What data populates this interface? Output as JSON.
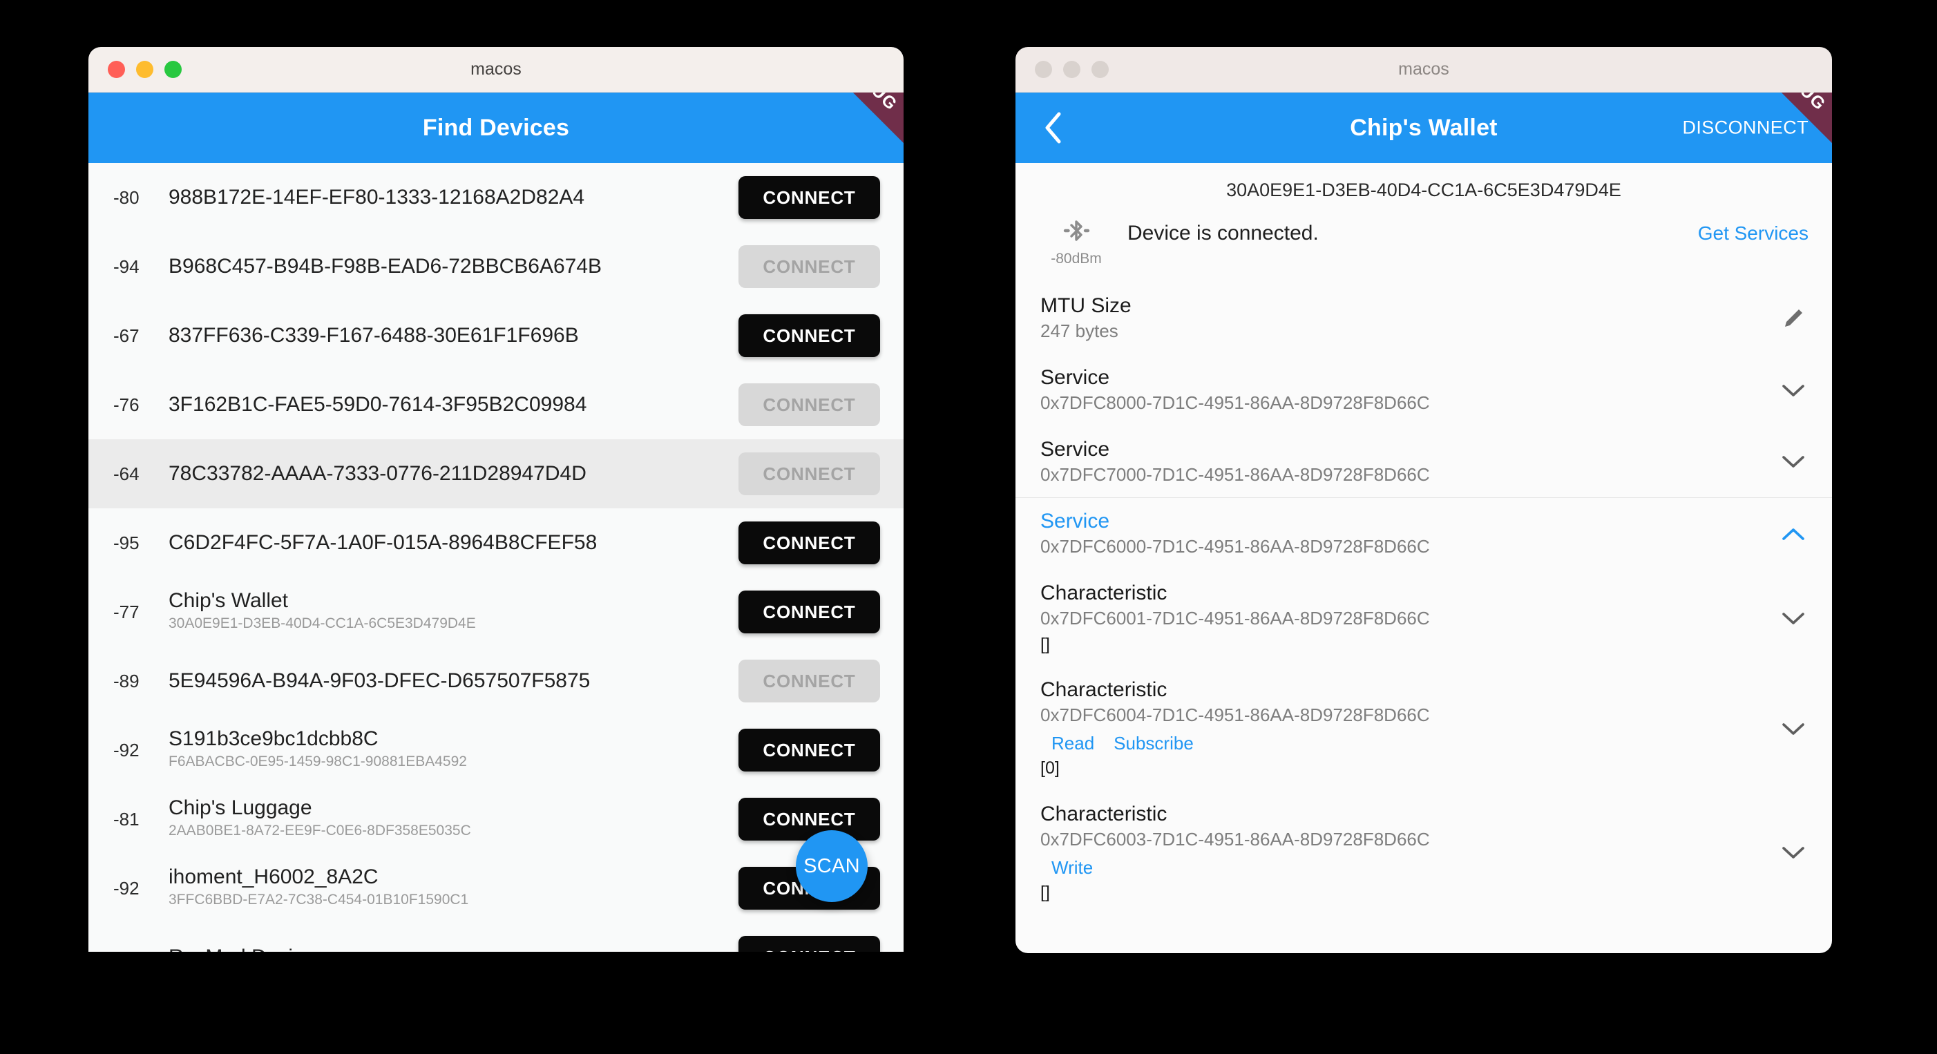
{
  "windows": {
    "left": {
      "os_title": "macos",
      "appbar_title": "Find Devices",
      "ribbon_label": "DEBUG",
      "scan_button_label": "SCAN",
      "traffic_lights": [
        "close",
        "minimize",
        "zoom"
      ],
      "devices": [
        {
          "rssi": "-80",
          "name": "988B172E-14EF-EF80-1333-12168A2D82A4",
          "sub": "",
          "button_label": "CONNECT",
          "enabled": true,
          "highlighted": false
        },
        {
          "rssi": "-94",
          "name": "B968C457-B94B-F98B-EAD6-72BBCB6A674B",
          "sub": "",
          "button_label": "CONNECT",
          "enabled": false,
          "highlighted": false
        },
        {
          "rssi": "-67",
          "name": "837FF636-C339-F167-6488-30E61F1F696B",
          "sub": "",
          "button_label": "CONNECT",
          "enabled": true,
          "highlighted": false
        },
        {
          "rssi": "-76",
          "name": "3F162B1C-FAE5-59D0-7614-3F95B2C09984",
          "sub": "",
          "button_label": "CONNECT",
          "enabled": false,
          "highlighted": false
        },
        {
          "rssi": "-64",
          "name": "78C33782-AAAA-7333-0776-211D28947D4D",
          "sub": "",
          "button_label": "CONNECT",
          "enabled": false,
          "highlighted": true
        },
        {
          "rssi": "-95",
          "name": "C6D2F4FC-5F7A-1A0F-015A-8964B8CFEF58",
          "sub": "",
          "button_label": "CONNECT",
          "enabled": true,
          "highlighted": false
        },
        {
          "rssi": "-77",
          "name": "Chip's Wallet",
          "sub": "30A0E9E1-D3EB-40D4-CC1A-6C5E3D479D4E",
          "button_label": "CONNECT",
          "enabled": true,
          "highlighted": false
        },
        {
          "rssi": "-89",
          "name": "5E94596A-B94A-9F03-DFEC-D657507F5875",
          "sub": "",
          "button_label": "CONNECT",
          "enabled": false,
          "highlighted": false
        },
        {
          "rssi": "-92",
          "name": "S191b3ce9bc1dcbb8C",
          "sub": "F6ABACBC-0E95-1459-98C1-90881EBA4592",
          "button_label": "CONNECT",
          "enabled": true,
          "highlighted": false
        },
        {
          "rssi": "-81",
          "name": "Chip's Luggage",
          "sub": "2AAB0BE1-8A72-EE9F-C0E6-8DF358E5035C",
          "button_label": "CONNECT",
          "enabled": true,
          "highlighted": false
        },
        {
          "rssi": "-92",
          "name": "ihoment_H6002_8A2C",
          "sub": "3FFC6BBD-E7A2-7C38-C454-01B10F1590C1",
          "button_label": "CONNECT",
          "enabled": true,
          "highlighted": false
        },
        {
          "rssi": "",
          "name": "ResMed Device",
          "sub": "",
          "button_label": "CONNECT",
          "enabled": true,
          "highlighted": false
        }
      ]
    },
    "right": {
      "os_title": "macos",
      "appbar_title": "Chip's Wallet",
      "ribbon_label": "DEBUG",
      "back_label": "back",
      "disconnect_label": "DISCONNECT",
      "device_uuid": "30A0E9E1-D3EB-40D4-CC1A-6C5E3D479D4E",
      "signal_dbm": "-80dBm",
      "status_text": "Device is connected.",
      "get_services_label": "Get Services",
      "mtu": {
        "title": "MTU Size",
        "value": "247 bytes"
      },
      "entries": [
        {
          "kind": "service",
          "title": "Service",
          "uuid": "0x7DFC8000-7D1C-4951-86AA-8D9728F8D66C",
          "expanded": false,
          "accent": false,
          "value": "",
          "links": [],
          "divider_above": false
        },
        {
          "kind": "service",
          "title": "Service",
          "uuid": "0x7DFC7000-7D1C-4951-86AA-8D9728F8D66C",
          "expanded": false,
          "accent": false,
          "value": "",
          "links": [],
          "divider_above": false
        },
        {
          "kind": "service",
          "title": "Service",
          "uuid": "0x7DFC6000-7D1C-4951-86AA-8D9728F8D66C",
          "expanded": true,
          "accent": true,
          "value": "",
          "links": [],
          "divider_above": true
        },
        {
          "kind": "characteristic",
          "title": "Characteristic",
          "uuid": "0x7DFC6001-7D1C-4951-86AA-8D9728F8D66C",
          "expanded": false,
          "accent": false,
          "value": "[]",
          "links": [],
          "divider_above": false
        },
        {
          "kind": "characteristic",
          "title": "Characteristic",
          "uuid": "0x7DFC6004-7D1C-4951-86AA-8D9728F8D66C",
          "expanded": false,
          "accent": false,
          "value": "[0]",
          "links": [
            "Read",
            "Subscribe"
          ],
          "divider_above": false
        },
        {
          "kind": "characteristic",
          "title": "Characteristic",
          "uuid": "0x7DFC6003-7D1C-4951-86AA-8D9728F8D66C",
          "expanded": false,
          "accent": false,
          "value": "[]",
          "links": [
            "Write"
          ],
          "divider_above": false
        }
      ]
    }
  },
  "colors": {
    "accent_blue": "#2096F3",
    "debug_ribbon": "#7E1D2D",
    "connect_enabled_bg": "#0A0A0A",
    "connect_disabled_bg": "#D8D8D8",
    "titlebar_bg": "#F4EFEC",
    "page_bg": "#000000"
  }
}
